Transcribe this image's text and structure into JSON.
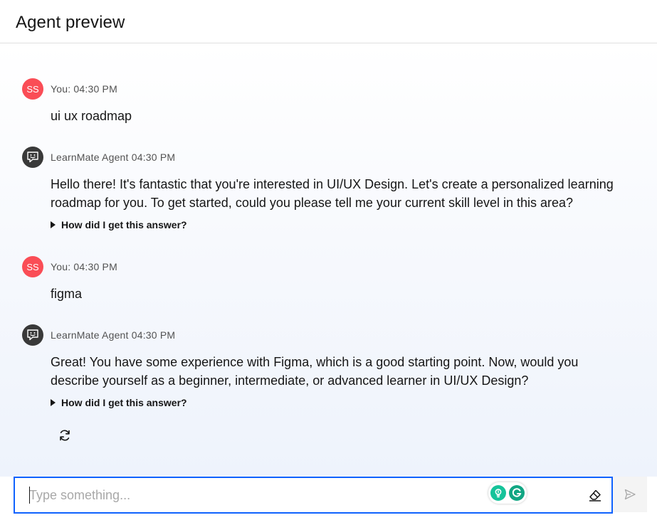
{
  "header": {
    "title": "Agent preview"
  },
  "messages": [
    {
      "sender": "user",
      "avatar_initials": "SS",
      "meta": "You: 04:30 PM",
      "text": "ui ux roadmap"
    },
    {
      "sender": "agent",
      "avatar_icon": "chat-bot-icon",
      "meta": "LearnMate Agent 04:30 PM",
      "text": "Hello there! It's fantastic that you're interested in UI/UX Design. Let's create a personalized learning roadmap for you. To get started, could you please tell me your current skill level in this area?",
      "explain_label": "How did I get this answer?"
    },
    {
      "sender": "user",
      "avatar_initials": "SS",
      "meta": "You: 04:30 PM",
      "text": "figma"
    },
    {
      "sender": "agent",
      "avatar_icon": "chat-bot-icon",
      "meta": "LearnMate Agent 04:30 PM",
      "text": "Great! You have some experience with Figma, which is a good starting point. Now, would you describe yourself as a beginner, intermediate, or advanced learner in UI/UX Design?",
      "explain_label": "How did I get this answer?"
    }
  ],
  "actions": {
    "regenerate_icon": "refresh-icon"
  },
  "composer": {
    "placeholder": "Type something...",
    "value": "",
    "clear_icon": "eraser-icon",
    "send_icon": "send-icon",
    "extension_icons": [
      "lightbulb-icon",
      "grammarly-icon"
    ]
  },
  "colors": {
    "accent": "#0f62fe",
    "user_avatar": "#fa4d56",
    "agent_avatar": "#393939",
    "extension_green": "#15c39a"
  }
}
